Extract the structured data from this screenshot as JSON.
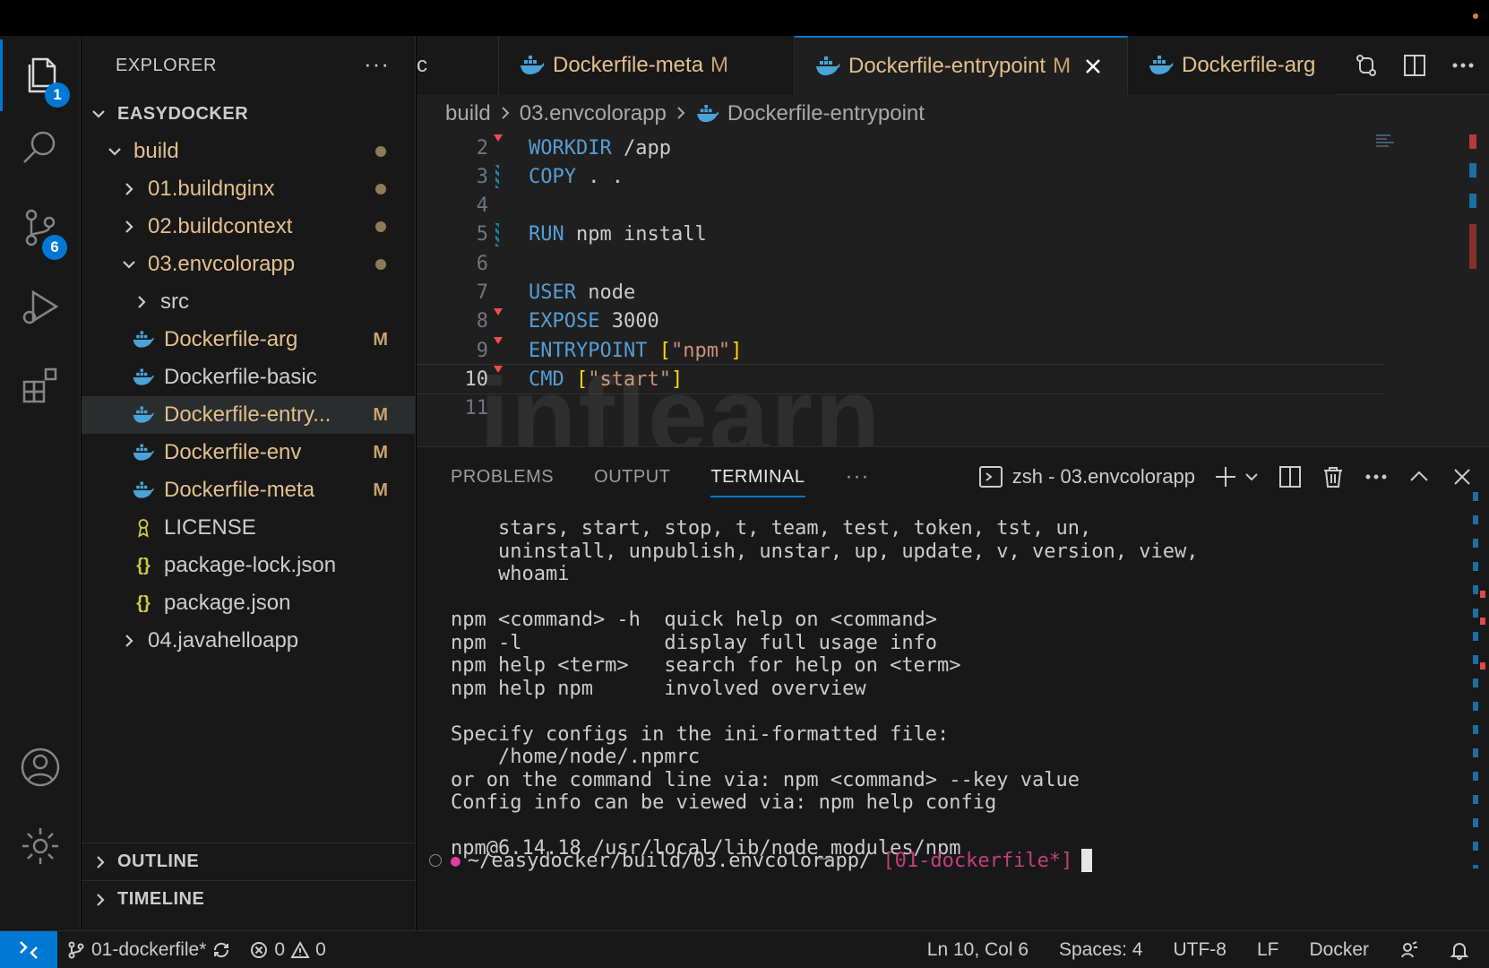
{
  "sidebar": {
    "header": "EXPLORER",
    "root": "EASYDOCKER",
    "tree": [
      {
        "label": "build",
        "indent": 1,
        "type": "folder-open",
        "cls": "modified",
        "dot": true
      },
      {
        "label": "01.buildnginx",
        "indent": 2,
        "type": "folder",
        "cls": "modified",
        "dot": true
      },
      {
        "label": "02.buildcontext",
        "indent": 2,
        "type": "folder",
        "cls": "modified",
        "dot": true
      },
      {
        "label": "03.envcolorapp",
        "indent": 2,
        "type": "folder-open",
        "cls": "modified",
        "dot": true
      },
      {
        "label": "src",
        "indent": 3,
        "type": "folder",
        "cls": "plain"
      },
      {
        "label": "Dockerfile-arg",
        "indent": 3,
        "type": "docker",
        "cls": "modified",
        "mark": "M"
      },
      {
        "label": "Dockerfile-basic",
        "indent": 3,
        "type": "docker",
        "cls": "plain"
      },
      {
        "label": "Dockerfile-entry...",
        "indent": 3,
        "type": "docker",
        "cls": "modified",
        "mark": "M",
        "selected": true
      },
      {
        "label": "Dockerfile-env",
        "indent": 3,
        "type": "docker",
        "cls": "modified",
        "mark": "M"
      },
      {
        "label": "Dockerfile-meta",
        "indent": 3,
        "type": "docker",
        "cls": "modified",
        "mark": "M"
      },
      {
        "label": "LICENSE",
        "indent": 3,
        "type": "license",
        "cls": "plain"
      },
      {
        "label": "package-lock.json",
        "indent": 3,
        "type": "json",
        "cls": "plain"
      },
      {
        "label": "package.json",
        "indent": 3,
        "type": "json",
        "cls": "plain"
      },
      {
        "label": "04.javahelloapp",
        "indent": 2,
        "type": "folder",
        "cls": "plain"
      }
    ],
    "outline": "OUTLINE",
    "timeline": "TIMELINE"
  },
  "activity": {
    "explorer_badge": "1",
    "scm_badge": "6"
  },
  "tabs": {
    "partial": "c",
    "items": [
      {
        "label": "Dockerfile-meta",
        "mark": "M"
      },
      {
        "label": "Dockerfile-entrypoint",
        "mark": "M"
      },
      {
        "label": "Dockerfile-arg"
      }
    ]
  },
  "breadcrumb": [
    "build",
    "03.envcolorapp",
    "Dockerfile-entrypoint"
  ],
  "code": [
    {
      "n": "2",
      "parts": [
        [
          "kw",
          "WORKDIR"
        ],
        [
          "",
          " /app"
        ]
      ]
    },
    {
      "n": "3",
      "parts": [
        [
          "kw",
          "COPY"
        ],
        [
          "",
          " . ."
        ]
      ]
    },
    {
      "n": "4",
      "parts": []
    },
    {
      "n": "5",
      "parts": [
        [
          "kw",
          "RUN"
        ],
        [
          "",
          " npm install"
        ]
      ]
    },
    {
      "n": "6",
      "parts": []
    },
    {
      "n": "7",
      "parts": [
        [
          "kw",
          "USER"
        ],
        [
          "",
          " node"
        ]
      ]
    },
    {
      "n": "8",
      "parts": [
        [
          "kw",
          "EXPOSE"
        ],
        [
          "",
          " 3000"
        ]
      ]
    },
    {
      "n": "9",
      "parts": [
        [
          "kw",
          "ENTRYPOINT"
        ],
        [
          "",
          " "
        ],
        [
          "brk",
          "["
        ],
        [
          "str",
          "\"npm\""
        ],
        [
          "brk",
          "]"
        ]
      ]
    },
    {
      "n": "10",
      "parts": [
        [
          "kw",
          "CMD"
        ],
        [
          "",
          " "
        ],
        [
          "brk",
          "["
        ],
        [
          "str",
          "\"start\""
        ],
        [
          "brk",
          "]"
        ]
      ],
      "current": true
    },
    {
      "n": "11",
      "parts": []
    }
  ],
  "panel": {
    "tabs": [
      "PROBLEMS",
      "OUTPUT",
      "TERMINAL"
    ],
    "active_tab": "TERMINAL",
    "terminal_name": "zsh - 03.envcolorapp",
    "lines": [
      "    stars, start, stop, t, team, test, token, tst, un,",
      "    uninstall, unpublish, unstar, up, update, v, version, view,",
      "    whoami",
      "",
      "npm <command> -h  quick help on <command>",
      "npm -l            display full usage info",
      "npm help <term>   search for help on <term>",
      "npm help npm      involved overview",
      "",
      "Specify configs in the ini-formatted file:",
      "    /home/node/.npmrc",
      "or on the command line via: npm <command> --key value",
      "Config info can be viewed via: npm help config",
      "",
      "npm@6.14.18 /usr/local/lib/node_modules/npm"
    ],
    "prompt_path": "~/easydocker/build/03.envcolorapp/",
    "prompt_branch": "[01-dockerfile*]"
  },
  "status": {
    "branch": "01-dockerfile*",
    "errors": "0",
    "warnings": "0",
    "position": "Ln 10, Col 6",
    "spaces": "Spaces: 4",
    "encoding": "UTF-8",
    "eol": "LF",
    "language": "Docker"
  },
  "watermark": "inflearn",
  "colors": {
    "accent": "#0078d4",
    "modified": "#e2c08d",
    "keyword": "#569cd6",
    "string": "#ce9178"
  }
}
